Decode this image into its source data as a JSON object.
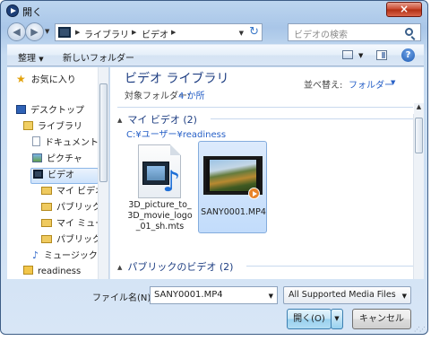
{
  "window": {
    "title": "開く",
    "close_label": "×"
  },
  "nav": {
    "back_icon": "back-arrow-icon",
    "forward_icon": "forward-arrow-icon",
    "breadcrumb": [
      "ライブラリ",
      "ビデオ"
    ],
    "search_placeholder": "ビデオの検索"
  },
  "toolbar": {
    "organize": "整理",
    "new_folder": "新しいフォルダー",
    "help": "?"
  },
  "sidebar": {
    "items": [
      {
        "label": "お気に入り",
        "icon": "star-icon"
      },
      {
        "label": "デスクトップ",
        "icon": "desktop-icon"
      },
      {
        "label": "ライブラリ",
        "icon": "library-icon"
      },
      {
        "label": "ドキュメント",
        "icon": "documents-icon"
      },
      {
        "label": "ピクチャ",
        "icon": "pictures-icon"
      },
      {
        "label": "ビデオ",
        "icon": "videos-icon",
        "selected": true
      },
      {
        "label": "マイ ビデオ",
        "icon": "folder-icon"
      },
      {
        "label": "パブリックの",
        "icon": "folder-icon"
      },
      {
        "label": "マイ ミュージ",
        "icon": "folder-icon"
      },
      {
        "label": "パブリックの",
        "icon": "folder-icon"
      },
      {
        "label": "ミュージック",
        "icon": "music-icon"
      },
      {
        "label": "readiness",
        "icon": "user-folder-icon"
      }
    ]
  },
  "content": {
    "library_title": "ビデオ ライブラリ",
    "target_label": "対象フォルダー:",
    "target_count": "4 か所",
    "arrange_label": "並べ替え:",
    "arrange_value": "フォルダー",
    "groups": [
      {
        "title": "マイ ビデオ (2)",
        "path": "C:¥ユーザー¥readiness"
      },
      {
        "title": "パブリックのビデオ (2)"
      }
    ],
    "files": [
      {
        "name": "3D_picture_to_3D_movie_logo_01_sh.mts",
        "selected": false
      },
      {
        "name": "SANY0001.MP4",
        "selected": true
      }
    ]
  },
  "footer": {
    "filename_label": "ファイル名(N):",
    "filename_value": "SANY0001.MP4",
    "filter_value": "All Supported Media Files",
    "open_label": "開く(O)",
    "cancel_label": "キャンセル"
  },
  "colors": {
    "accent": "#1e3e82",
    "link": "#2760c7",
    "close_button": "#c8452b"
  }
}
